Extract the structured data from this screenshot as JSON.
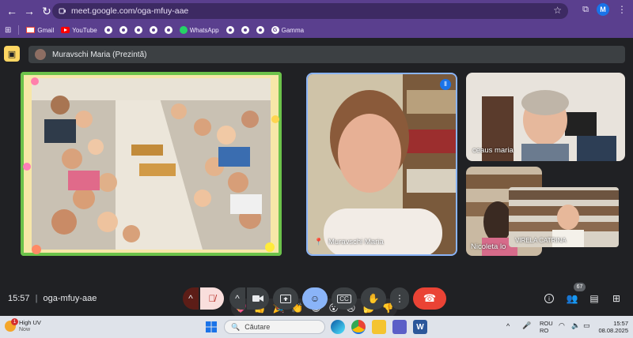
{
  "browser": {
    "url": "meet.google.com/oga-mfuy-aae",
    "profile_initial": "M"
  },
  "bookmarks": [
    {
      "label": "Gmail",
      "icon": "gmail-icon"
    },
    {
      "label": "YouTube",
      "icon": "youtube-icon"
    },
    {
      "label": "",
      "icon": "site-icon"
    },
    {
      "label": "",
      "icon": "site-icon"
    },
    {
      "label": "",
      "icon": "site-icon"
    },
    {
      "label": "",
      "icon": "site-icon"
    },
    {
      "label": "",
      "icon": "site-icon"
    },
    {
      "label": "WhatsApp",
      "icon": "whatsapp-icon"
    },
    {
      "label": "",
      "icon": "site-icon"
    },
    {
      "label": "",
      "icon": "site-icon"
    },
    {
      "label": "",
      "icon": "site-icon"
    },
    {
      "label": "Gamma",
      "icon": "gamma-icon"
    }
  ],
  "meet": {
    "presenter_label": "Muravschi Maria (Prezintă)",
    "participants": [
      {
        "name": "Muravschi Maria"
      },
      {
        "name": "ceaus maria"
      },
      {
        "name": "Nicoleta lo"
      },
      {
        "name": "VIRELA CATRINA"
      }
    ],
    "reactions": [
      "💖",
      "👍",
      "🎉",
      "👏",
      "😂",
      "😮",
      "😢",
      "🤔",
      "👎"
    ],
    "time": "15:57",
    "meeting_code": "oga-mfuy-aae",
    "participant_count": "67"
  },
  "taskbar": {
    "weather_badge": "1",
    "weather_title": "High UV",
    "weather_sub": "Now",
    "search_placeholder": "Căutare",
    "lang_top": "ROU",
    "lang_bottom": "RO",
    "clock_time": "15:57",
    "clock_date": "08.08.2025"
  },
  "colors": {
    "chrome_purple": "#5a3f8e",
    "meet_bg": "#202124",
    "end_call_red": "#ea4335",
    "active_blue": "#8ab4f8"
  }
}
